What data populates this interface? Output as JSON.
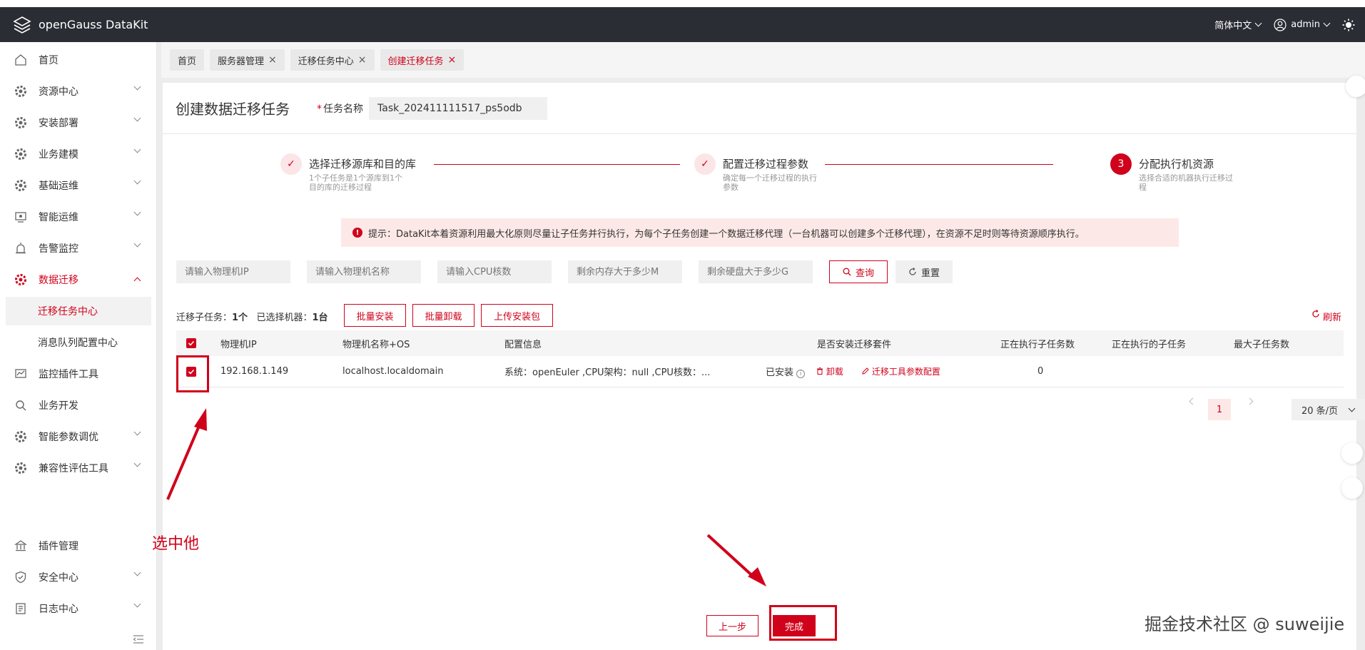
{
  "app": {
    "title": "openGauss DataKit"
  },
  "header": {
    "language": "简体中文",
    "user": "admin"
  },
  "sidebar": {
    "items": [
      {
        "label": "首页",
        "icon": "home-icon",
        "expandable": false
      },
      {
        "label": "资源中心",
        "icon": "gear-icon",
        "expandable": true
      },
      {
        "label": "安装部署",
        "icon": "gear-icon",
        "expandable": true
      },
      {
        "label": "业务建模",
        "icon": "gear-icon",
        "expandable": true
      },
      {
        "label": "基础运维",
        "icon": "gear-icon",
        "expandable": true
      },
      {
        "label": "智能运维",
        "icon": "monitor-icon",
        "expandable": true
      },
      {
        "label": "告警监控",
        "icon": "alarm-icon",
        "expandable": true
      },
      {
        "label": "数据迁移",
        "icon": "gear-icon",
        "expandable": true,
        "active": true
      },
      {
        "label": "迁移任务中心",
        "sub": true,
        "selected": true
      },
      {
        "label": "消息队列配置中心",
        "sub": true
      },
      {
        "label": "监控插件工具",
        "icon": "plugin-icon",
        "expandable": false
      },
      {
        "label": "业务开发",
        "icon": "search-icon",
        "expandable": false
      },
      {
        "label": "智能参数调优",
        "icon": "gear-icon",
        "expandable": true
      },
      {
        "label": "兼容性评估工具",
        "icon": "gear-icon",
        "expandable": true
      },
      {
        "label": "插件管理",
        "icon": "bank-icon",
        "expandable": false
      },
      {
        "label": "安全中心",
        "icon": "shield-icon",
        "expandable": true
      },
      {
        "label": "日志中心",
        "icon": "log-icon",
        "expandable": true
      }
    ]
  },
  "tabs": [
    {
      "label": "首页",
      "closable": false
    },
    {
      "label": "服务器管理",
      "closable": true
    },
    {
      "label": "迁移任务中心",
      "closable": true
    },
    {
      "label": "创建迁移任务",
      "closable": true,
      "active": true
    }
  ],
  "page": {
    "title": "创建数据迁移任务",
    "task_name_label": "任务名称",
    "task_name_value": "Task_202411111517_ps5odb"
  },
  "steps": [
    {
      "title": "选择迁移源库和目的库",
      "desc": "1个子任务是1个源库到1个目的库的迁移过程",
      "status": "done"
    },
    {
      "title": "配置迁移过程参数",
      "desc": "确定每一个迁移过程的执行参数",
      "status": "done"
    },
    {
      "number": "3",
      "title": "分配执行机资源",
      "desc": "选择合适的机器执行迁移过程",
      "status": "current"
    }
  ],
  "notice": "提示：DataKit本着资源利用最大化原则尽量让子任务并行执行，为每个子任务创建一个数据迁移代理（一台机器可以创建多个迁移代理），在资源不足时则等待资源顺序执行。",
  "filters": {
    "ip_placeholder": "请输入物理机IP",
    "name_placeholder": "请输入物理机名称",
    "cpu_placeholder": "请输入CPU核数",
    "memory_placeholder": "剩余内存大于多少M",
    "disk_placeholder": "剩余硬盘大于多少G",
    "query_label": "查询",
    "reset_label": "重置"
  },
  "summary": {
    "subtask_label": "迁移子任务：",
    "subtask_count": "1个",
    "selected_label": "已选择机器：",
    "selected_count": "1台",
    "batch_install": "批量安装",
    "batch_uninstall": "批量卸载",
    "upload_package": "上传安装包",
    "refresh": "刷新"
  },
  "table": {
    "columns": [
      "物理机IP",
      "物理机名称+OS",
      "配置信息",
      "是否安装迁移套件",
      "正在执行子任务数",
      "正在执行的子任务",
      "最大子任务数"
    ],
    "rows": [
      {
        "ip": "192.168.1.149",
        "name": "localhost.localdomain",
        "config": "系统：openEuler ,CPU架构：null ,CPU核数：...",
        "installed": "已安装",
        "uninstall": "卸载",
        "param_config": "迁移工具参数配置",
        "running_count": "0",
        "running_tasks": "",
        "max_tasks": ""
      }
    ]
  },
  "pagination": {
    "current": "1",
    "page_size": "20 条/页"
  },
  "footer": {
    "prev_label": "上一步",
    "finish_label": "完成"
  },
  "annotation": {
    "text": "选中他"
  },
  "watermark": "掘金技术社区 @ suweijie",
  "colors": {
    "accent": "#d0021b",
    "header_bg": "#2a2d34"
  }
}
